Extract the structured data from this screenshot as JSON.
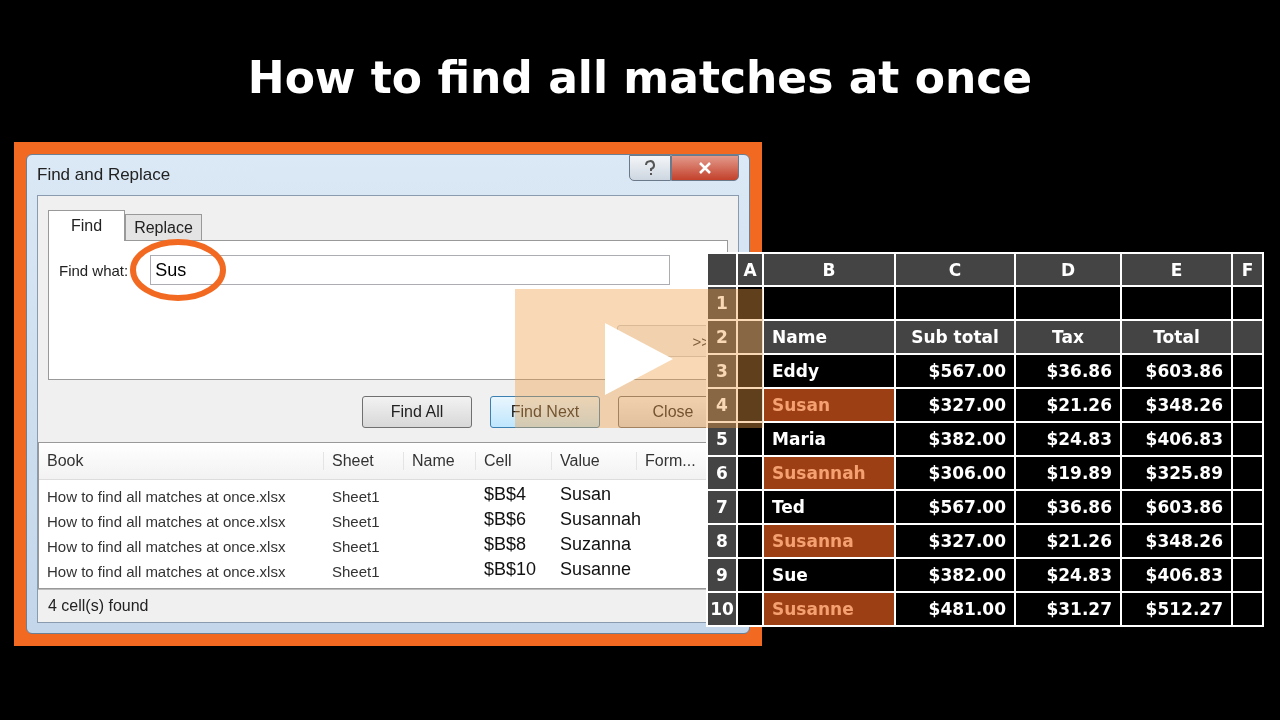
{
  "title": "How to find all matches at once",
  "dialog": {
    "title": "Find and Replace",
    "tabs": [
      {
        "label": "Find",
        "selected": true
      },
      {
        "label": "Replace",
        "selected": false
      }
    ],
    "find_label": "Find what:",
    "find_value": "Sus",
    "options_button": ">>",
    "buttons": [
      {
        "label": "Find All",
        "kind": "normal"
      },
      {
        "label": "Find Next",
        "kind": "default"
      },
      {
        "label": "Close",
        "kind": "normal"
      }
    ],
    "results": {
      "columns": [
        "Book",
        "Sheet",
        "Name",
        "Cell",
        "Value",
        "Form..."
      ],
      "rows": [
        {
          "book": "How to find all matches at once.xlsx",
          "sheet": "Sheet1",
          "cell": "$B$4",
          "value": "Susan"
        },
        {
          "book": "How to find all matches at once.xlsx",
          "sheet": "Sheet1",
          "cell": "$B$6",
          "value": "Susannah"
        },
        {
          "book": "How to find all matches at once.xlsx",
          "sheet": "Sheet1",
          "cell": "$B$8",
          "value": "Suzanna"
        },
        {
          "book": "How to find all matches at once.xlsx",
          "sheet": "Sheet1",
          "cell": "$B$10",
          "value": "Susanne"
        }
      ]
    },
    "status": "4 cell(s) found"
  },
  "sheet": {
    "columns": [
      "A",
      "B",
      "C",
      "D",
      "E",
      "F"
    ],
    "rows": [
      {
        "num": "1",
        "kind": "blank",
        "cells": []
      },
      {
        "num": "2",
        "kind": "header",
        "cells": [
          "",
          "Name",
          "Sub total",
          "Tax",
          "Total"
        ]
      },
      {
        "num": "3",
        "kind": "data",
        "highlighted": false,
        "cells": [
          "",
          "Eddy",
          "$567.00",
          "$36.86",
          "$603.86"
        ]
      },
      {
        "num": "4",
        "kind": "data",
        "highlighted": true,
        "cells": [
          "",
          "Susan",
          "$327.00",
          "$21.26",
          "$348.26"
        ]
      },
      {
        "num": "5",
        "kind": "data",
        "highlighted": false,
        "cells": [
          "",
          "Maria",
          "$382.00",
          "$24.83",
          "$406.83"
        ]
      },
      {
        "num": "6",
        "kind": "data",
        "highlighted": true,
        "cells": [
          "",
          "Susannah",
          "$306.00",
          "$19.89",
          "$325.89"
        ]
      },
      {
        "num": "7",
        "kind": "data",
        "highlighted": false,
        "cells": [
          "",
          "Ted",
          "$567.00",
          "$36.86",
          "$603.86"
        ]
      },
      {
        "num": "8",
        "kind": "data",
        "highlighted": true,
        "cells": [
          "",
          "Susanna",
          "$327.00",
          "$21.26",
          "$348.26"
        ]
      },
      {
        "num": "9",
        "kind": "data",
        "highlighted": false,
        "cells": [
          "",
          "Sue",
          "$382.00",
          "$24.83",
          "$406.83"
        ]
      },
      {
        "num": "10",
        "kind": "data",
        "highlighted": true,
        "cells": [
          "",
          "Susanne",
          "$481.00",
          "$31.27",
          "$512.27"
        ]
      }
    ]
  }
}
